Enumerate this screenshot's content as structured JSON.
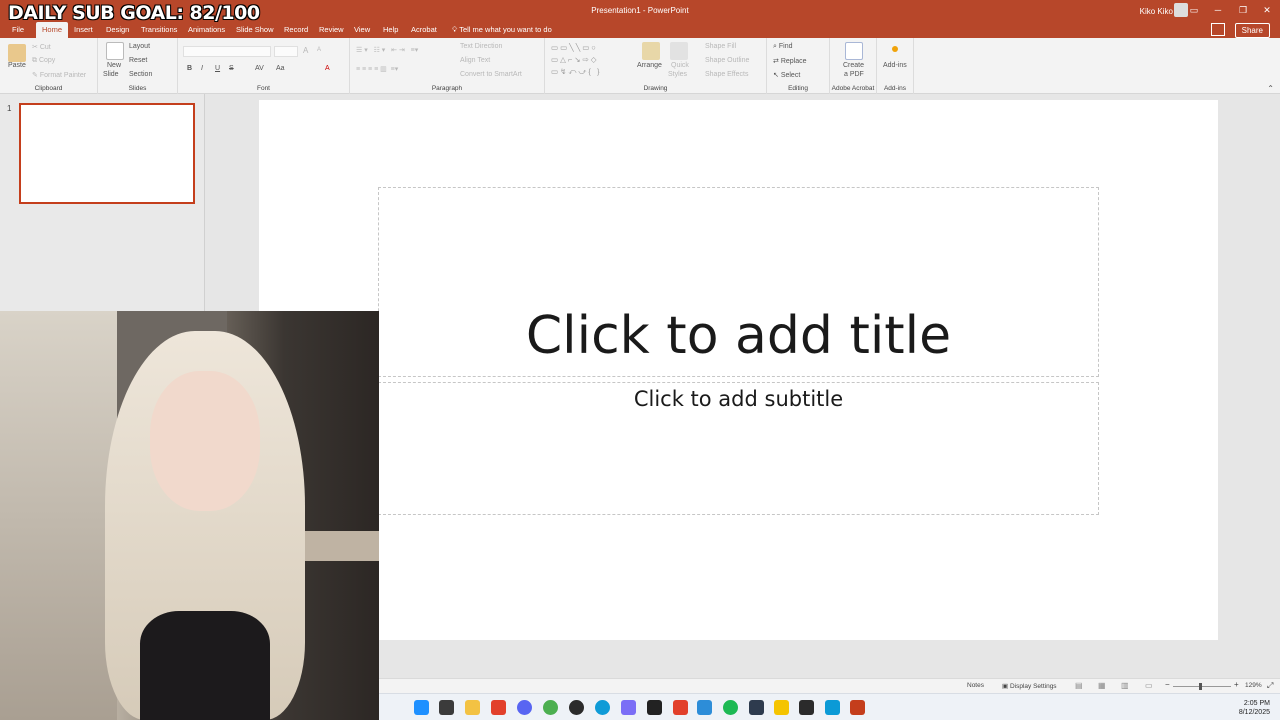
{
  "overlay": {
    "goal_text": "DAILY SUB GOAL: 82/100"
  },
  "window": {
    "title": "Presentation1  -  PowerPoint",
    "user": "Kiko Kiko",
    "minimize": "─",
    "restore": "❐",
    "close": "✕",
    "ribbon_display": "▭"
  },
  "tabs": [
    {
      "label": "File"
    },
    {
      "label": "Home"
    },
    {
      "label": "Insert"
    },
    {
      "label": "Design"
    },
    {
      "label": "Transitions"
    },
    {
      "label": "Animations"
    },
    {
      "label": "Slide Show"
    },
    {
      "label": "Record"
    },
    {
      "label": "Review"
    },
    {
      "label": "View"
    },
    {
      "label": "Help"
    },
    {
      "label": "Acrobat"
    }
  ],
  "tellme": "Tell me what you want to do",
  "share": "Share",
  "ribbon": {
    "clipboard": {
      "label": "Clipboard",
      "paste": "Paste",
      "cut": "Cut",
      "copy": "Copy",
      "format_painter": "Format Painter"
    },
    "slides": {
      "label": "Slides",
      "new_slide_1": "New",
      "new_slide_2": "Slide",
      "layout": "Layout",
      "reset": "Reset",
      "section": "Section"
    },
    "font": {
      "label": "Font",
      "bold": "B",
      "italic": "I",
      "underline": "U",
      "strike": "S",
      "spacing": "AV",
      "case": "Aa",
      "color": "A",
      "grow": "A",
      "shrink": "A"
    },
    "paragraph": {
      "label": "Paragraph",
      "text_direction": "Text Direction",
      "align_text": "Align Text",
      "smartart": "Convert to SmartArt"
    },
    "drawing": {
      "label": "Drawing",
      "arrange": "Arrange",
      "quick_styles_1": "Quick",
      "quick_styles_2": "Styles",
      "shape_fill": "Shape Fill",
      "shape_outline": "Shape Outline",
      "shape_effects": "Shape Effects"
    },
    "editing": {
      "label": "Editing",
      "find": "Find",
      "replace": "Replace",
      "select": "Select"
    },
    "acrobat": {
      "label": "Adobe Acrobat",
      "create_1": "Create",
      "create_2": "a PDF"
    },
    "addins": {
      "label": "Add-ins",
      "button": "Add-ins"
    }
  },
  "slide_panel": {
    "number": "1"
  },
  "slide": {
    "title_placeholder": "Click to add title",
    "subtitle_placeholder": "Click to add subtitle"
  },
  "status": {
    "notes": "Notes",
    "display_settings": "Display Settings",
    "zoom": "129%",
    "zoom_level": 0.45
  },
  "taskbar": {
    "time": "2:05 PM",
    "date": "8/12/2025"
  },
  "colors": {
    "accent": "#b7472a",
    "selection": "#c43e1c"
  }
}
